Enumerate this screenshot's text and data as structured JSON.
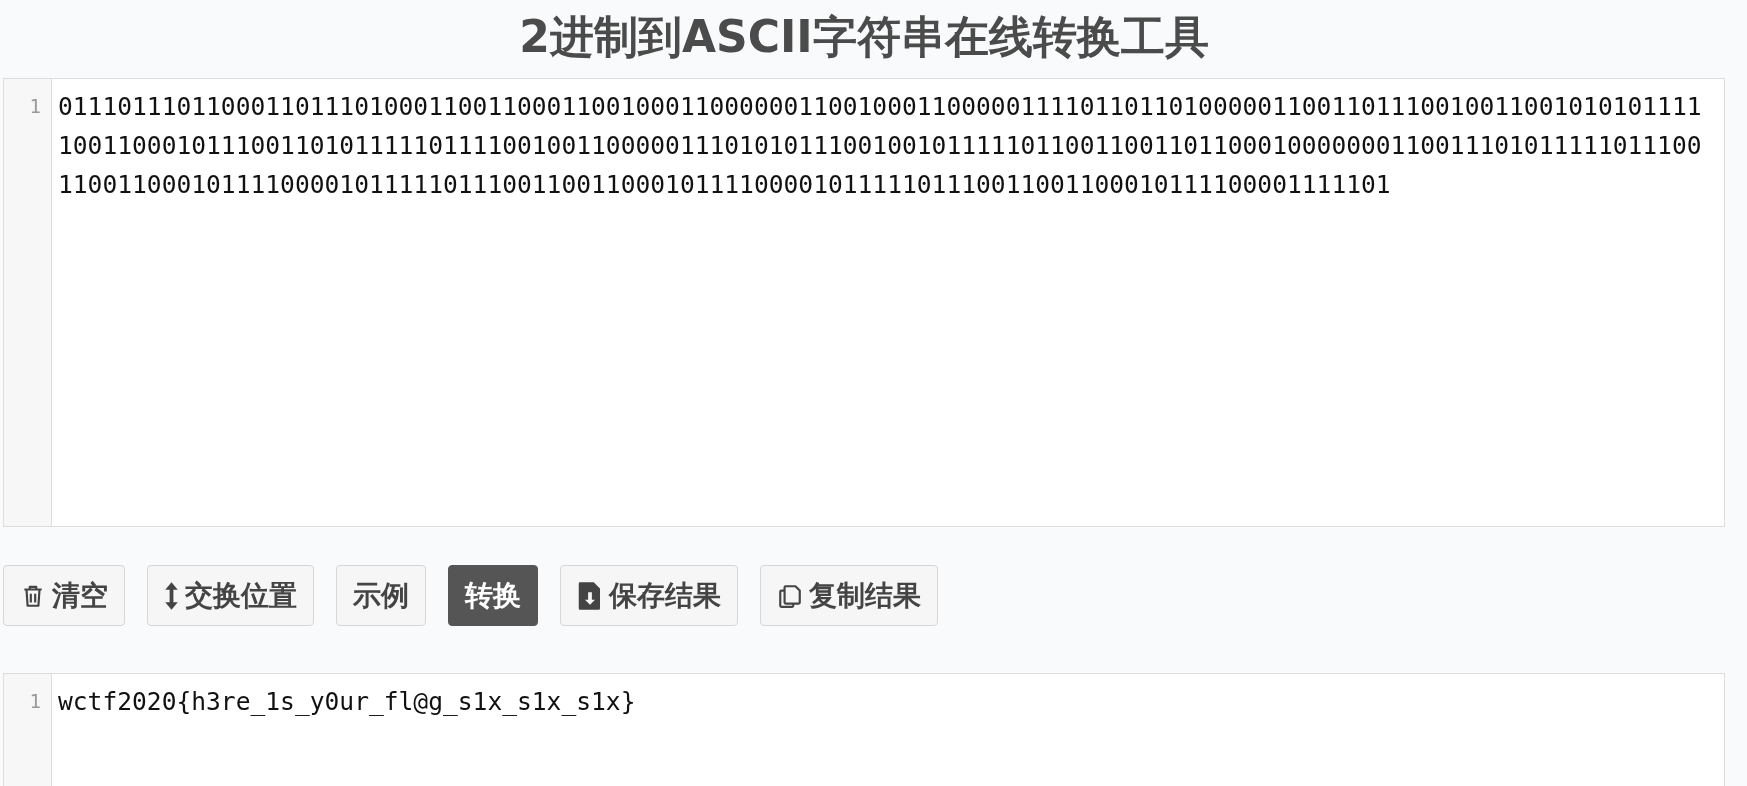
{
  "title": "2进制到ASCII字符串在线转换工具",
  "input": {
    "line_number": "1",
    "value": "011101110110001101110100011001100011001000110000001100100011000001111011011010000011001101110010011001010101111100110001011100110101111101111001001100000111010101110010010111110110011001101100010000000110011101011111011100110011000101111000010111110111001100110001011110000101111101110011001100010111100001111101"
  },
  "buttons": [
    {
      "label": "清空",
      "kind": "clear",
      "selected": false
    },
    {
      "label": "交换位置",
      "kind": "swap",
      "selected": false
    },
    {
      "label": "示例",
      "kind": "example",
      "selected": false
    },
    {
      "label": "转换",
      "kind": "convert",
      "selected": true
    },
    {
      "label": "保存结果",
      "kind": "save",
      "selected": false
    },
    {
      "label": "复制结果",
      "kind": "copy",
      "selected": false
    }
  ],
  "output": {
    "line_number": "1",
    "value": "wctf2020{h3re_1s_y0ur_fl@g_s1x_s1x_s1x}"
  }
}
